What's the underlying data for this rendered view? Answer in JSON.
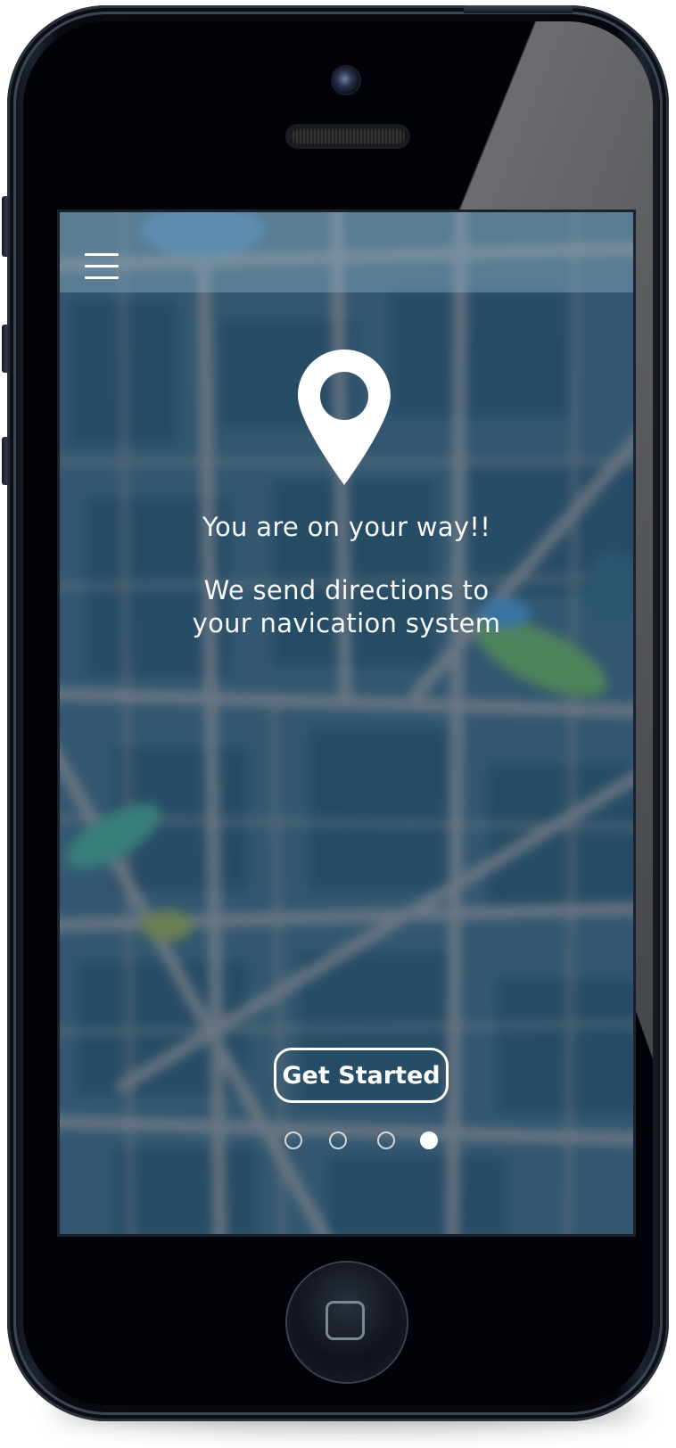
{
  "screen": {
    "menu_icon": "hamburger-menu-icon",
    "hero_icon": "location-pin-icon",
    "title": "You are on your way!!",
    "subtitle_line1": "We send directions to",
    "subtitle_line2": "your navication system",
    "cta_label": "Get Started",
    "pagination": {
      "total": 4,
      "active_index": 3
    }
  },
  "colors": {
    "accent_text": "#ffffff",
    "overlay": "#1c4862"
  }
}
